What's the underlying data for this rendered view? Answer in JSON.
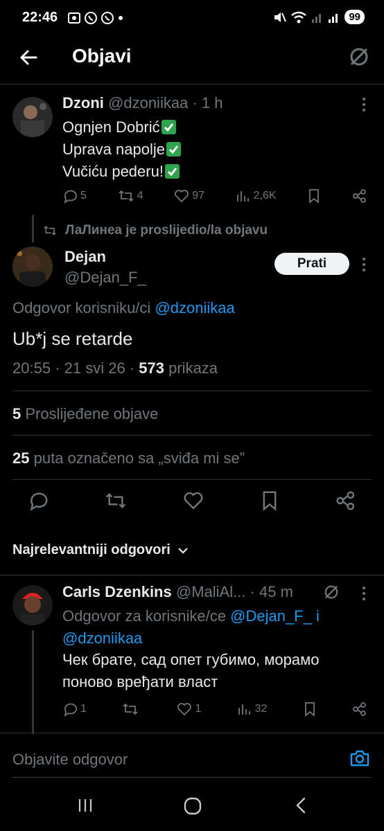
{
  "status_bar": {
    "time": "22:46",
    "battery": "99"
  },
  "header": {
    "title": "Objavi"
  },
  "tweet1": {
    "name": "Dzoni",
    "handle": "@dzoniikaa",
    "time": "1 h",
    "lines": [
      "Ognjen Dobrić",
      "Uprava napolje",
      "Vučiću pederu!"
    ],
    "replies": "5",
    "reposts": "4",
    "likes": "97",
    "views": "2,6K"
  },
  "repost_label": "ЛаЛинеа je proslijedio/la objavu",
  "main_tweet": {
    "name": "Dejan",
    "handle": "@Dejan_F_",
    "follow_label": "Prati",
    "reply_to_prefix": "Odgovor korisniku/ci",
    "reply_to_handle": "@dzoniikaa",
    "text": "Ub*j se retarde",
    "time": "20:55",
    "date": "21 svi 26",
    "views_count": "573",
    "views_label": "prikaza",
    "reposts_count": "5",
    "reposts_label": "Proslijeđene objave",
    "likes_count": "25",
    "likes_label": "puta označeno sa „sviđa mi se”"
  },
  "sort_label": "Najrelevantniji odgovori",
  "reply1": {
    "name": "Carls Dzenkins",
    "handle": "@MaliAl...",
    "time": "45 m",
    "reply_prefix": "Odgovor za korisnike/ce",
    "reply_handle1": "@Dejan_F_",
    "reply_joiner": "i",
    "reply_handle2": "@dzoniikaa",
    "text": "Чек брате, сад опет губимо, морамо поново врeђати власт",
    "replies": "1",
    "reposts": "",
    "likes": "1",
    "views": "32"
  },
  "compose": {
    "placeholder": "Objavite odgovor"
  },
  "colors": {
    "background": "#000000",
    "link": "#1d9bf0",
    "muted": "#71767b",
    "check": "#2ea44f"
  }
}
